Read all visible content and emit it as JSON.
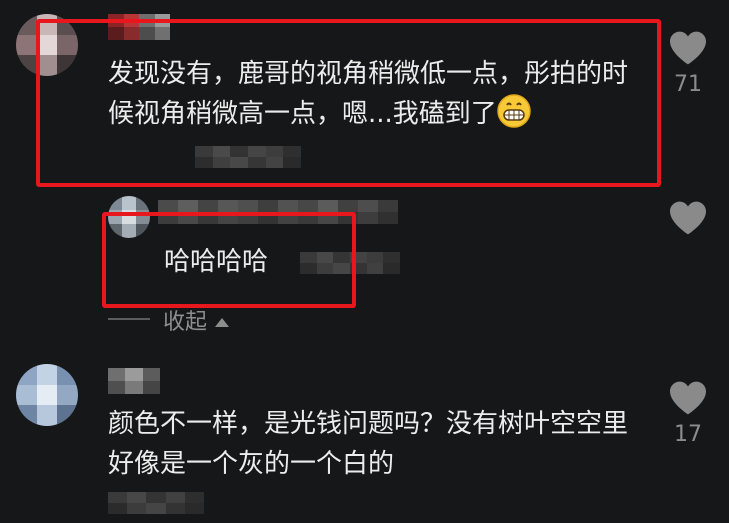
{
  "comments": [
    {
      "text": "发现没有，鹿哥的视角稍微低一点，彤拍的时候视角稍微高一点，嗯...我磕到了",
      "likes": "71",
      "emoji": "grinning-face-emoji",
      "highlighted": true
    },
    {
      "text": "颜色不一样，是光钱问题吗？没有树叶空空里好像是一个灰的一个白的",
      "likes": "17",
      "highlighted": false
    }
  ],
  "reply": {
    "text": "哈哈哈哈",
    "highlighted": true
  },
  "collapse_label": "收起",
  "colors": {
    "background": "#161718",
    "text": "#ececec",
    "muted": "#8c8c8c",
    "highlight": "#e8171e",
    "heart": "#8a8a8a"
  }
}
